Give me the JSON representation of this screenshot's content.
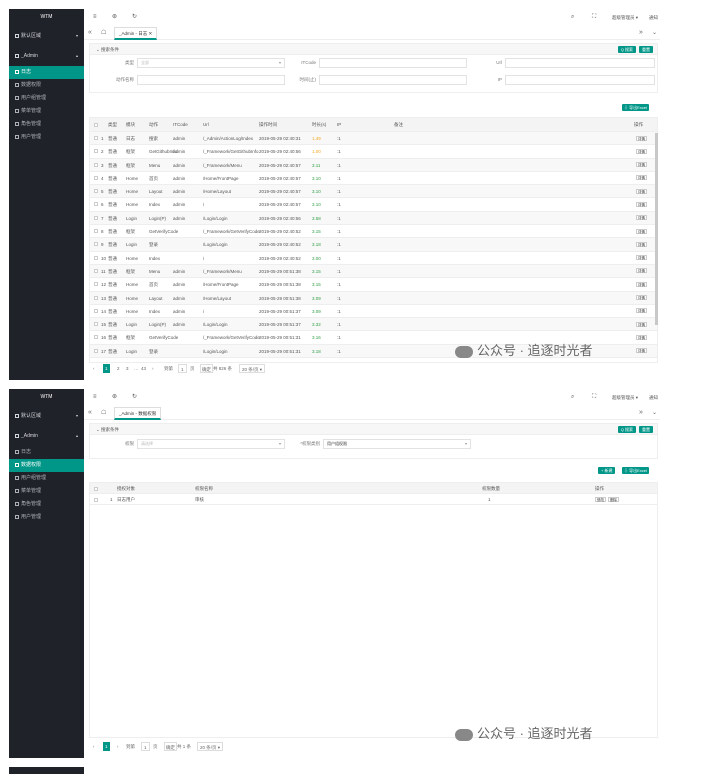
{
  "s1": {
    "logo": "WTM",
    "sidebar": [
      {
        "label": "默认区域",
        "group": true,
        "arrow": "▾"
      },
      {
        "label": "_Admin",
        "group": true,
        "arrow": "▴"
      },
      {
        "label": "日志",
        "active": true
      },
      {
        "label": "数据权限"
      },
      {
        "label": "用户组管理"
      },
      {
        "label": "菜单管理"
      },
      {
        "label": "角色管理"
      },
      {
        "label": "用户管理"
      }
    ],
    "header": {
      "icons": [
        "≡",
        "⊛",
        "↻"
      ],
      "right_icons": [
        "⌕",
        "⛶"
      ],
      "user": "超级管理员 ▾",
      "notify": "通知"
    },
    "tab": "_Admin - 日志 ✕",
    "tabbar": {
      "left": "«",
      "home": "☖",
      "right1": "»",
      "right2": "⌄"
    },
    "query": {
      "title": "⌄ 搜索条件",
      "search_btn": "Q 搜索",
      "reset_btn": "重置",
      "fields": [
        {
          "label": "类型",
          "ph": "全部"
        },
        {
          "label": "ITCode",
          "ph": ""
        },
        {
          "label": "Url",
          "ph": ""
        },
        {
          "label": "动作名称",
          "ph": ""
        },
        {
          "label": "时间(止)",
          "ph": ""
        },
        {
          "label": "IP",
          "ph": ""
        }
      ]
    },
    "export_btn": "⇩ 导出Excel",
    "columns": [
      "",
      "类型",
      "模块",
      "动作",
      "ITCode",
      "Url",
      "操作时间",
      "时长(s)",
      "IP",
      "备注",
      "操作"
    ],
    "rows": [
      [
        "1",
        "普通",
        "日志",
        "搜索",
        "admin",
        "/_Admin/ActionLog/Index",
        "2019-05-29 02:40:31",
        "1.49",
        ":1",
        "",
        "详情"
      ],
      [
        "2",
        "普通",
        "框架",
        "GetGithubInfo",
        "admin",
        "/_Framework/GetGithubInfo",
        "2019-05-29 02:40:56",
        "1.00",
        ":1",
        "",
        "详情"
      ],
      [
        "3",
        "普通",
        "框架",
        "Menu",
        "admin",
        "/_Framework/Menu",
        "2019-05-29 02:40:57",
        "3.11",
        ":1",
        "",
        "详情"
      ],
      [
        "4",
        "普通",
        "Home",
        "首页",
        "admin",
        "/Home/FrontPage",
        "2019-05-29 02:40:57",
        "3.10",
        ":1",
        "",
        "详情"
      ],
      [
        "5",
        "普通",
        "Home",
        "Layout",
        "admin",
        "/Home/Layout",
        "2019-05-29 02:40:57",
        "3.10",
        ":1",
        "",
        "详情"
      ],
      [
        "6",
        "普通",
        "Home",
        "Index",
        "admin",
        "/",
        "2019-05-29 02:40:57",
        "3.10",
        ":1",
        "",
        "详情"
      ],
      [
        "7",
        "普通",
        "Login",
        "Login(P)",
        "admin",
        "/Login/Login",
        "2019-05-29 02:40:56",
        "3.58",
        ":1",
        "",
        "详情"
      ],
      [
        "8",
        "普通",
        "框架",
        "GetVerifyCode",
        "",
        "/_Framework/GetVerifyCode",
        "2019-05-29 02:40:52",
        "3.15",
        ":1",
        "",
        "详情"
      ],
      [
        "9",
        "普通",
        "Login",
        "登录",
        "",
        "/Login/Login",
        "2019-05-29 02:40:52",
        "3.18",
        ":1",
        "",
        "详情"
      ],
      [
        "10",
        "普通",
        "Home",
        "Index",
        "",
        "/",
        "2019-05-29 02:40:52",
        "3.00",
        ":1",
        "",
        "详情"
      ],
      [
        "11",
        "普通",
        "框架",
        "Menu",
        "admin",
        "/_Framework/Menu",
        "2019-05-29 00:51:38",
        "3.15",
        ":1",
        "",
        "详情"
      ],
      [
        "12",
        "普通",
        "Home",
        "首页",
        "admin",
        "/Home/FrontPage",
        "2019-05-29 00:51:38",
        "3.15",
        ":1",
        "",
        "详情"
      ],
      [
        "13",
        "普通",
        "Home",
        "Layout",
        "admin",
        "/Home/Layout",
        "2019-05-29 00:51:38",
        "3.09",
        ":1",
        "",
        "详情"
      ],
      [
        "14",
        "普通",
        "Home",
        "Index",
        "admin",
        "/",
        "2019-05-29 00:51:37",
        "3.09",
        ":1",
        "",
        "详情"
      ],
      [
        "15",
        "普通",
        "Login",
        "Login(P)",
        "admin",
        "/Login/Login",
        "2019-05-29 00:51:37",
        "3.32",
        ":1",
        "",
        "详情"
      ],
      [
        "16",
        "普通",
        "框架",
        "GetVerifyCode",
        "",
        "/_Framework/GetVerifyCode",
        "2019-05-29 00:51:31",
        "3.16",
        ":1",
        "",
        "详情"
      ],
      [
        "17",
        "普通",
        "Login",
        "登录",
        "",
        "/Login/Login",
        "2019-05-29 00:51:31",
        "3.18",
        ":1",
        "",
        "详情"
      ]
    ],
    "pager": {
      "prev": "‹",
      "cur": "1",
      "p2": "2",
      "p3": "3",
      "dots": "…",
      "last": "43",
      "next": "›",
      "goto": "到第",
      "page_val": "1",
      "page_unit": "页",
      "ok": "确定",
      "total": "共 826 条",
      "size": "20 条/页 ▾"
    },
    "watermark": "公众号 · 追逐时光者"
  },
  "s2": {
    "logo": "WTM",
    "sidebar": [
      {
        "label": "默认区域",
        "group": true,
        "arrow": "▾"
      },
      {
        "label": "_Admin",
        "group": true,
        "arrow": "▴"
      },
      {
        "label": "日志"
      },
      {
        "label": "数据权限",
        "active": true
      },
      {
        "label": "用户组管理"
      },
      {
        "label": "菜单管理"
      },
      {
        "label": "角色管理"
      },
      {
        "label": "用户管理"
      }
    ],
    "header": {
      "icons": [
        "≡",
        "⊛",
        "↻"
      ],
      "right_icons": [
        "⌕",
        "⛶"
      ],
      "user": "超级管理员 ▾",
      "notify": "通知"
    },
    "tab": "_Admin - 数据权限",
    "tabbar": {
      "left": "«",
      "home": "☖",
      "right1": "»",
      "right2": "⌄"
    },
    "query": {
      "title": "⌄ 搜索条件",
      "search_btn": "Q 搜索",
      "reset_btn": "重置",
      "fields": [
        {
          "label": "权限",
          "ph": "请选择"
        },
        {
          "label": "*权限类别",
          "ph": "用户组权限"
        }
      ]
    },
    "add_btn": "+ 新建",
    "export_btn": "⇩ 导出Excel",
    "columns": [
      "",
      "授权对象",
      "权限名称",
      "权限数量",
      "操作"
    ],
    "rows": [
      [
        "1",
        "日志用户",
        "审核",
        "1",
        "修改",
        "删除"
      ]
    ],
    "pager": {
      "prev": "‹",
      "cur": "1",
      "next": "›",
      "goto": "到第",
      "page_val": "1",
      "page_unit": "页",
      "ok": "确定",
      "total": "共 1 条",
      "size": "20 条/页 ▾"
    },
    "watermark": "公众号 · 追逐时光者"
  },
  "colors": {
    "accent": "#009688",
    "sidebar": "#20222a",
    "orange": "#f5a623",
    "green": "#2f9e44"
  }
}
